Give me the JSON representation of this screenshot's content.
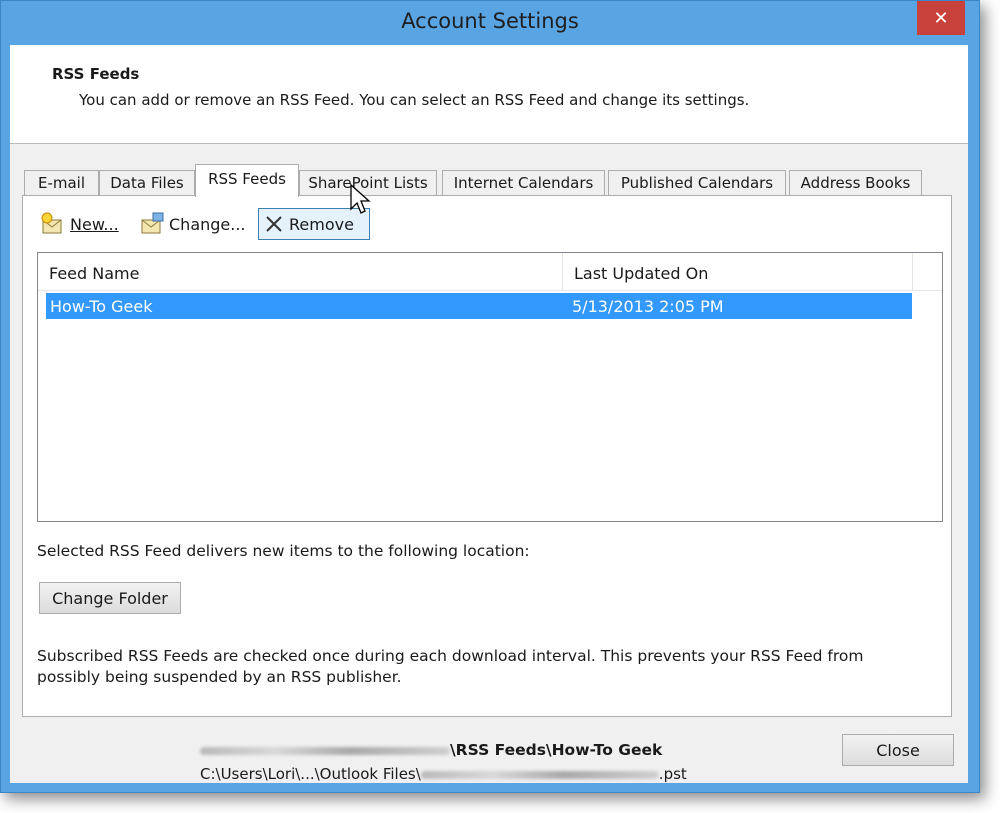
{
  "window": {
    "title": "Account Settings",
    "close_glyph": "✕"
  },
  "header": {
    "title": "RSS Feeds",
    "description": "You can add or remove an RSS Feed. You can select an RSS Feed and change its settings."
  },
  "tabs": [
    {
      "label": "E-mail"
    },
    {
      "label": "Data Files"
    },
    {
      "label": "RSS Feeds",
      "active": true
    },
    {
      "label": "SharePoint Lists"
    },
    {
      "label": "Internet Calendars"
    },
    {
      "label": "Published Calendars"
    },
    {
      "label": "Address Books"
    }
  ],
  "toolbar": {
    "new_label": "New...",
    "change_label": "Change...",
    "remove_label": "Remove"
  },
  "feeds": {
    "columns": [
      "Feed Name",
      "Last Updated On"
    ],
    "rows": [
      {
        "name": "How-To Geek",
        "updated": "5/13/2013 2:05 PM",
        "selected": true
      }
    ]
  },
  "location": {
    "label": "Selected RSS Feed delivers new items to the following location:",
    "change_folder_label": "Change Folder",
    "path_folder": "\\RSS Feeds\\How-To Geek",
    "path_file_prefix": "C:\\Users\\Lori\\...\\Outlook Files\\",
    "path_file_suffix": ".pst"
  },
  "note": "Subscribed RSS Feeds are checked once during each download interval. This prevents your RSS Feed from possibly being suspended by an RSS publisher.",
  "footer": {
    "close_label": "Close"
  },
  "colors": {
    "frame": "#59a4e3",
    "selection": "#3399ff",
    "close_red": "#c8413a"
  }
}
